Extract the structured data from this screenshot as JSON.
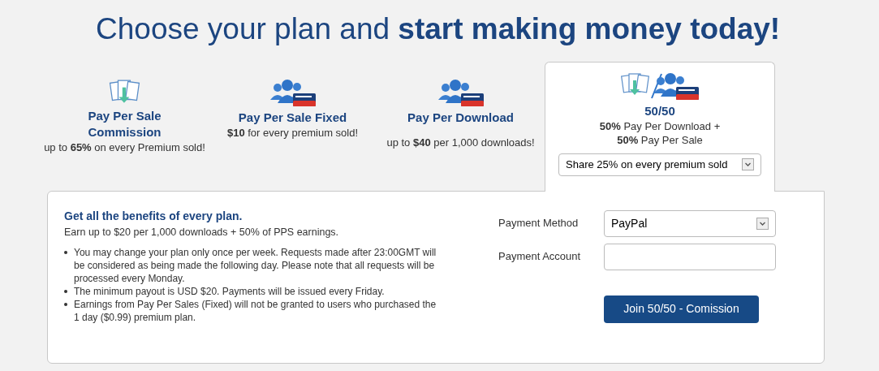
{
  "title": "Choose your plan and **start making money today!**",
  "plans": [
    {
      "kind": "download",
      "name": "Pay Per Sale Commission",
      "description": "up to **65%** on every Premium sold!",
      "selected": false
    },
    {
      "kind": "premium",
      "name": "Pay Per Sale Fixed",
      "description": "**$10** for every premium sold!",
      "selected": false
    },
    {
      "kind": "premium",
      "name": "Pay Per Download",
      "description": "up to **$40** per 1,000 downloads!",
      "selected": false
    },
    {
      "kind": "split",
      "name": "50/50",
      "description": "**50%** Pay Per Download +\n**50%** Pay Per Sale",
      "selected": true,
      "option": "Share 25% on every premium sold"
    }
  ],
  "details": {
    "heading": "Get all the benefits of every plan.",
    "subheading": "Earn up to $20 per 1,000 downloads + 50% of PPS earnings.",
    "notes": [
      "You may change your plan only once per week. Requests made after 23:00GMT will be considered as being made the following day. Please note that all requests will be processed every Monday.",
      "The minimum payout is USD $20. Payments will be issued every Friday.",
      "Earnings from Pay Per Sales (Fixed) will not be granted to users who purchased the 1 day ($0.99) premium plan."
    ]
  },
  "form": {
    "fields": [
      {
        "kind": "select",
        "label": "Payment Method",
        "value": "PayPal"
      },
      {
        "kind": "text",
        "label": "Payment Account"
      }
    ],
    "submit": "Join 50/50 - Comission"
  }
}
